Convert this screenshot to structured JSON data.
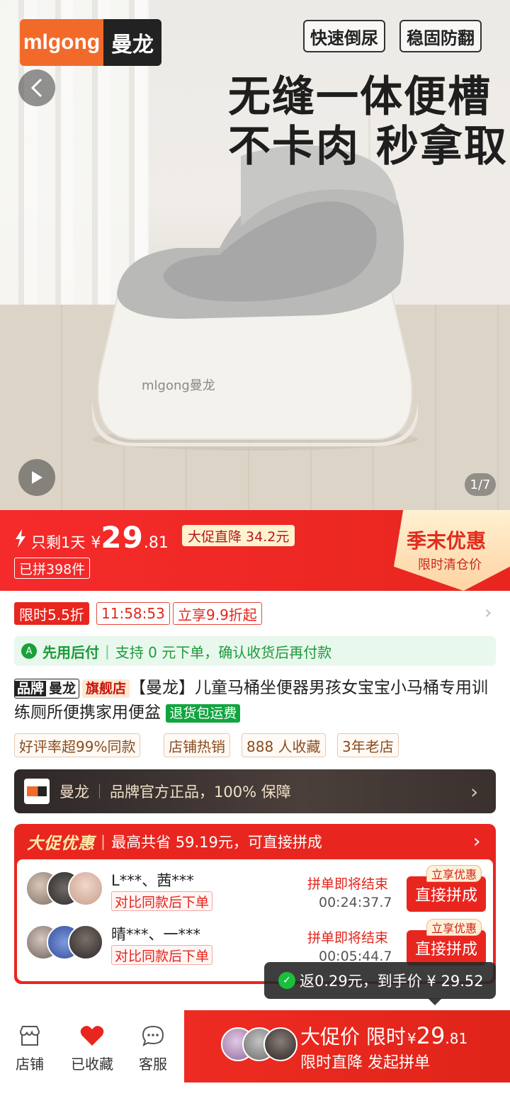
{
  "hero": {
    "logo_left": "mlgong",
    "logo_right": "曼龙",
    "tag1": "快速倒尿",
    "tag2": "稳固防翻",
    "headline1": "无缝一体便槽",
    "headline2": "不卡肉 秒拿取",
    "product_print": "mlgong曼龙",
    "image_counter": "1/7"
  },
  "price_banner": {
    "remaining": "只剩1天",
    "yen": "¥",
    "price_int": "29",
    "price_dec": ".81",
    "price_cut": "大促直降 34.2元",
    "sold": "已拼398件",
    "season_title": "季末优惠",
    "season_sub": "限时清仓价"
  },
  "flash": {
    "discount": "限时5.5折",
    "countdown": "11:58:53",
    "instant": "立享9.9折起"
  },
  "pay_later": {
    "label": "先用后付",
    "text": "支持 0 元下单，确认收货后再付款"
  },
  "product": {
    "brand_key": "品牌",
    "brand_name": "曼龙",
    "flagship": "旗舰店",
    "title": "【曼龙】儿童马桶坐便器男孩女宝宝小马桶专用训练厕所便携家用便盆",
    "return_tag": "退货包运费"
  },
  "pills": [
    "好评率超99%同款",
    "店铺热销",
    "888 人收藏",
    "3年老店"
  ],
  "store": {
    "name": "曼龙",
    "guarantee": "品牌官方正品，100% 保障"
  },
  "promo": {
    "logo": "大促优惠",
    "headline": "最高共省 59.19元，可直接拼成",
    "groups": [
      {
        "names": "L***、茜***",
        "compare": "对比同款后下单",
        "ending": "拼单即将结束",
        "timer": "00:24:37.7",
        "badge": "立享优惠",
        "button": "直接拼成"
      },
      {
        "names": "晴***、一***",
        "compare": "对比同款后下单",
        "ending": "拼单即将结束",
        "timer": "00:05:44.7",
        "badge": "立享优惠",
        "button": "直接拼成"
      }
    ]
  },
  "toast": {
    "text": "返0.29元，到手价 ¥ 29.52"
  },
  "bottom_bar": {
    "shop": "店铺",
    "favorited": "已收藏",
    "service": "客服",
    "buy_label": "大促价 限时",
    "buy_yen": "¥",
    "buy_int": "29",
    "buy_dec": ".81",
    "buy_sub": "限时直降 发起拼单"
  },
  "colors": {
    "accent_red": "#e8261f",
    "green": "#1c9a3c",
    "brand_orange": "#f26a2a"
  }
}
